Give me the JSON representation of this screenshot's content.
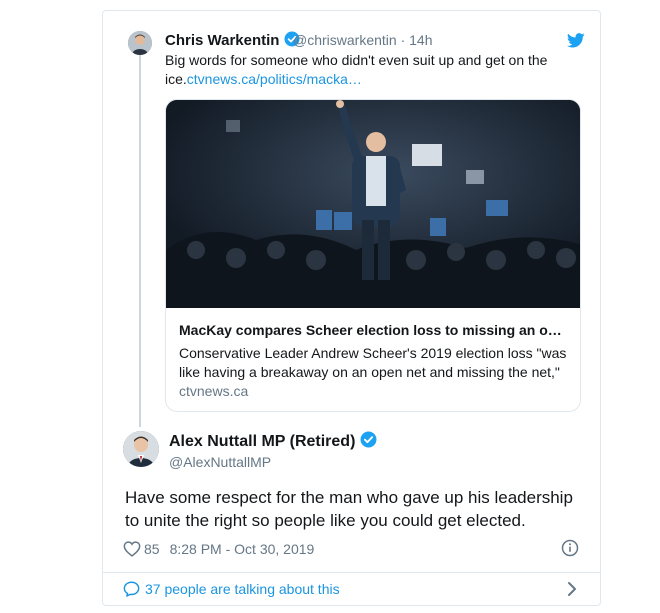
{
  "quoted_tweet": {
    "author_name": "Chris Warkentin",
    "handle": "@chriswarkentin",
    "separator": "·",
    "time": "14h",
    "text": "Big words for someone who didn't even suit up and get on the ice.",
    "link_text": "ctvnews.ca/politics/macka…",
    "card": {
      "title": "MacKay compares Scheer election loss to missing an o…",
      "description": "Conservative Leader Andrew Scheer's 2019 election loss \"was like having a breakaway on an open net and missing the net,\"",
      "domain": "ctvnews.ca"
    }
  },
  "main_tweet": {
    "author_name": "Alex Nuttall MP (Retired)",
    "handle": "@AlexNuttallMP",
    "text": "Have some respect for the man who gave up his leadership to unite the right so people like you could get elected.",
    "likes": "85",
    "timestamp": "8:28 PM - Oct 30, 2019"
  },
  "footer": {
    "talking_label": "37 people are talking about this"
  },
  "colors": {
    "accent": "#1b95e0",
    "verified": "#1da1f2",
    "secondary_text": "#657786",
    "border": "#e1e8ed"
  },
  "icons": [
    "verified-badge-icon",
    "twitter-bird-icon",
    "heart-icon",
    "info-icon",
    "speech-bubble-icon",
    "chevron-right-icon"
  ]
}
